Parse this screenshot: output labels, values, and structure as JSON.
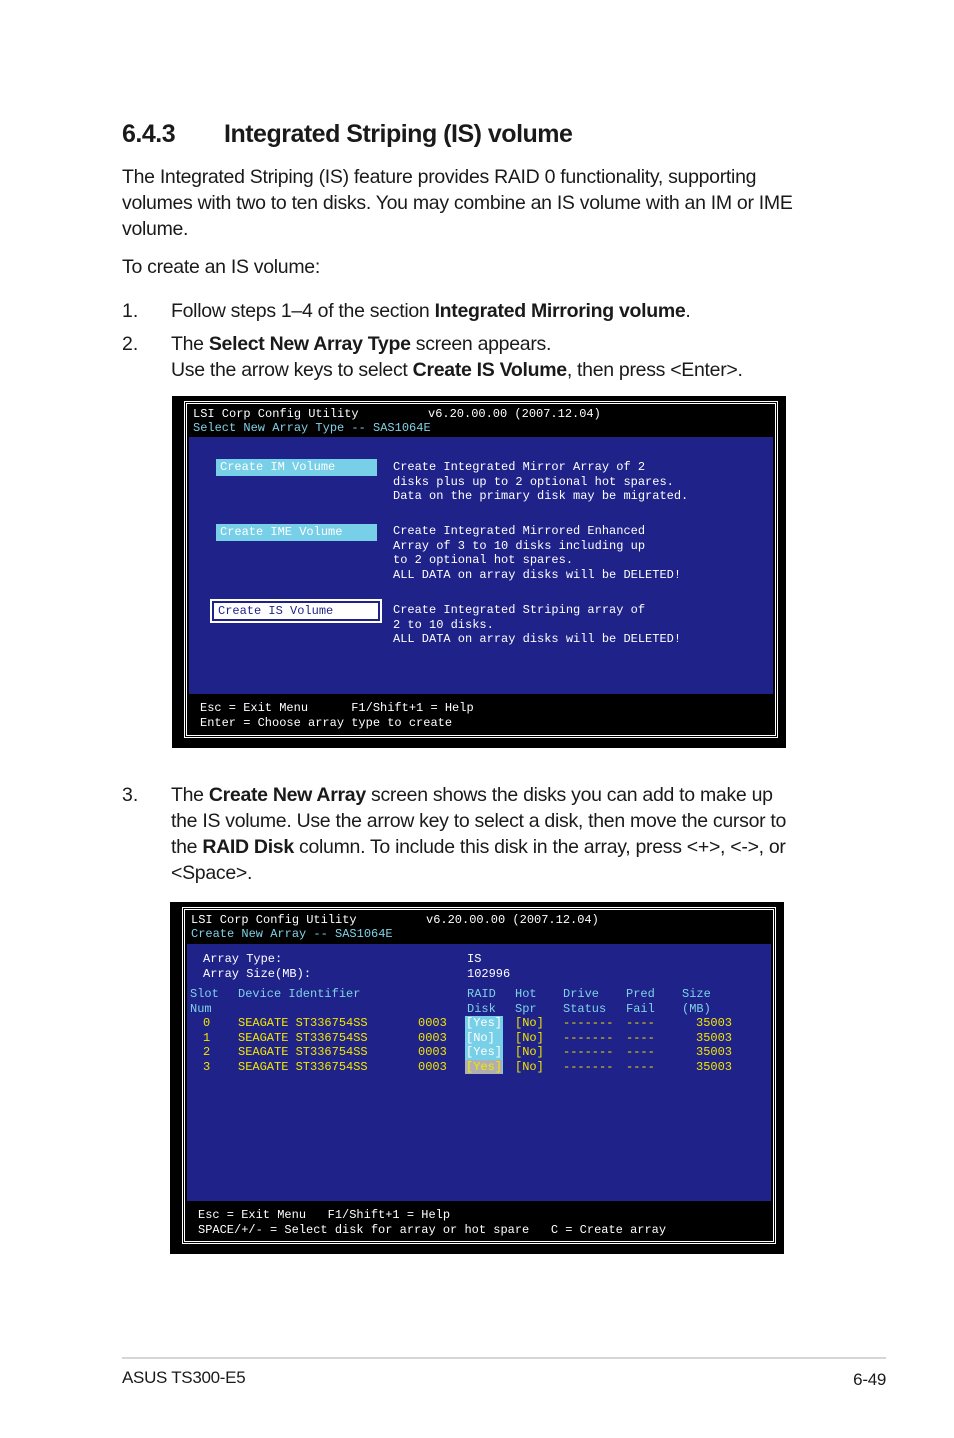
{
  "section": {
    "number": "6.4.3",
    "title": "Integrated Striping (IS) volume"
  },
  "intro": {
    "lines": [
      "The Integrated Striping (IS) feature provides RAID 0 functionality, supporting",
      "volumes with two to ten disks. You may combine an IS volume with an IM or IME",
      "volume."
    ],
    "lead": "To create an IS volume:"
  },
  "steps": [
    {
      "number": "1.",
      "pre": "Follow steps 1–4 of the section ",
      "bold": "Integrated Mirroring volume",
      "post": "."
    },
    {
      "number": "2.",
      "line1_pre": "The ",
      "line1_bold": "Select New Array Type",
      "line1_post": " screen appears.",
      "line2_pre": "Use the arrow keys to select ",
      "line2_bold": "Create IS Volume",
      "line2_post": ", then press <Enter>."
    },
    {
      "number": "3.",
      "line1_pre": "The ",
      "line1_bold": "Create New Array",
      "line1_post": " screen shows the disks you can add to make up",
      "line2": "the IS volume. Use the arrow key to select a disk, then move the cursor to",
      "line3_pre": "the ",
      "line3_bold": "RAID Disk",
      "line3_post": " column. To include this disk in the array, press <+>, <->, or",
      "line4": "<Space>."
    }
  ],
  "screen1": {
    "app_title": "LSI Corp Config Utility",
    "version": "v6.20.00.00 (2007.12.04)",
    "subtitle": "Select New Array Type -- SAS1064E",
    "options": [
      {
        "label": "Create IM Volume",
        "selected": false,
        "desc": [
          "Create Integrated Mirror Array of 2",
          "disks plus up to 2 optional hot spares.",
          "Data on the primary disk may be migrated."
        ]
      },
      {
        "label": "Create IME Volume",
        "selected": false,
        "desc": [
          "Create Integrated Mirrored Enhanced",
          "Array of 3 to 10 disks including up",
          "to 2 optional hot spares.",
          "ALL DATA on array disks will be DELETED!"
        ]
      },
      {
        "label": "Create IS Volume",
        "selected": true,
        "desc": [
          "Create Integrated Striping array of",
          "2 to 10 disks.",
          "ALL DATA on array disks will be DELETED!"
        ]
      }
    ],
    "help": [
      "Esc = Exit Menu      F1/Shift+1 = Help",
      "Enter = Choose array type to create"
    ]
  },
  "screen2": {
    "app_title": "LSI Corp Config Utility",
    "version": "v6.20.00.00 (2007.12.04)",
    "subtitle": "Create New Array -- SAS1064E",
    "array_type_label": "Array Type:",
    "array_type_value": "IS",
    "array_size_label": "Array Size(MB):",
    "array_size_value": "102996",
    "columns": {
      "slot": [
        "Slot",
        "Num"
      ],
      "device": [
        "Device Identifier",
        ""
      ],
      "raid": [
        "RAID",
        "Disk"
      ],
      "hot": [
        "Hot",
        "Spr"
      ],
      "drive": [
        "Drive",
        "Status"
      ],
      "pred": [
        "Pred",
        "Fail"
      ],
      "size": [
        "Size",
        "(MB)"
      ]
    },
    "rows": [
      {
        "slot": "0",
        "device": "SEAGATE ST336754SS",
        "rev": "0003",
        "raid": "[Yes]",
        "hot": "[No]",
        "status": "-------",
        "pred": "----",
        "size": "35003"
      },
      {
        "slot": "1",
        "device": "SEAGATE ST336754SS",
        "rev": "0003",
        "raid": "[No]",
        "hot": "[No]",
        "status": "-------",
        "pred": "----",
        "size": "35003"
      },
      {
        "slot": "2",
        "device": "SEAGATE ST336754SS",
        "rev": "0003",
        "raid": "[Yes]",
        "hot": "[No]",
        "status": "-------",
        "pred": "----",
        "size": "35003"
      },
      {
        "slot": "3",
        "device": "SEAGATE ST336754SS",
        "rev": "0003",
        "raid": "[Yes]",
        "hot": "[No]",
        "status": "-------",
        "pred": "----",
        "size": "35003"
      }
    ],
    "cursor_row": 3,
    "help": [
      "Esc = Exit Menu   F1/Shift+1 = Help",
      "SPACE/+/- = Select disk for array or hot spare   C = Create array"
    ]
  },
  "footer": {
    "product": "ASUS TS300-E5",
    "page": "6-49"
  },
  "colors": {
    "panel_blue": "#1f2389",
    "highlight_cyan": "#77d0e8",
    "text_yellow": "#f3e600",
    "cursor_gray": "#b0b0b0"
  }
}
